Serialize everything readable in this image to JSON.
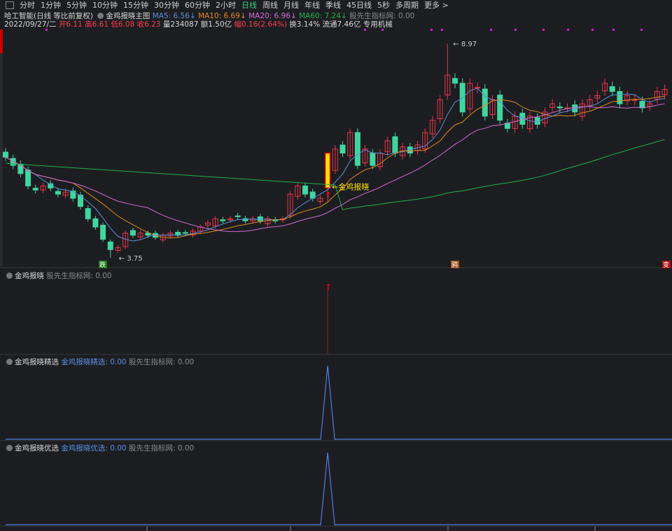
{
  "toolbar": {
    "periods": [
      "分时",
      "1分钟",
      "5分钟",
      "10分钟",
      "15分钟",
      "30分钟",
      "60分钟",
      "2小时",
      "日线",
      "周线",
      "月线",
      "年线",
      "季线",
      "45日线",
      "5秒",
      "多周期",
      "更多 >"
    ],
    "active": "日线"
  },
  "header": {
    "title": "哈工智能(日线 等比前复权)",
    "indicator": "金鸡报晓主图",
    "ma5": "MA5: 6.56",
    "ma10": "MA10: 6.69",
    "ma20": "MA20: 6.96",
    "ma60": "MA60: 7.24",
    "down_arrow": "↓",
    "site": "股先生指标网: 0.00",
    "date": "2022/09/27/二",
    "open": "开6.11",
    "high": "高6.61",
    "low": "低6.08",
    "close": "收6.23",
    "volume": "量234087",
    "amount": "额1.50亿",
    "change": "幅0.16(2.64%)",
    "turnover": "换3.14%",
    "float": "流通7.46亿",
    "sector": "专用机械"
  },
  "panels": [
    {
      "name": "金鸡报晓",
      "value_label": "",
      "site": "股先生指标网: 0.00"
    },
    {
      "name": "金鸡报晓精选",
      "value_label": "金鸡报晓精选: 0.00",
      "site": "股先生指标网: 0.00"
    },
    {
      "name": "金鸡报晓优选",
      "value_label": "金鸡报晓优选: 0.00",
      "site": "股先生指标网: 0.00"
    }
  ],
  "colors": {
    "up": "#e8344a",
    "down": "#3fd6a0",
    "ma5": "#5b8fd9",
    "ma10": "#e08a1e",
    "ma20": "#d36ad8",
    "ma60": "#21b14a",
    "signal": "#ffe600"
  },
  "chart_data": {
    "type": "candlestick",
    "closes": [
      6.2,
      6.0,
      5.8,
      5.5,
      5.4,
      5.5,
      5.45,
      5.3,
      5.35,
      5.2,
      5.0,
      4.7,
      4.5,
      4.2,
      3.95,
      4.0,
      4.35,
      4.3,
      4.35,
      4.3,
      4.25,
      4.3,
      4.35,
      4.3,
      4.35,
      4.4,
      4.5,
      4.6,
      4.7,
      4.65,
      4.7,
      4.75,
      4.65,
      4.7,
      4.65,
      4.7,
      4.65,
      4.7,
      5.3,
      5.5,
      5.3,
      5.2,
      5.2,
      5.85,
      6.4,
      6.3,
      6.8,
      6.0,
      6.4,
      6.0,
      6.3,
      6.6,
      6.3,
      6.45,
      6.3,
      6.5,
      6.8,
      7.1,
      7.6,
      8.2,
      8.0,
      7.3,
      8.0,
      7.9,
      7.2,
      7.6,
      7.1,
      6.9,
      7.2,
      7.0,
      7.2,
      7.0,
      7.3,
      7.5,
      7.4,
      7.4,
      7.3,
      7.5,
      7.6,
      7.7,
      8.0,
      7.8,
      7.5,
      7.7,
      7.6,
      7.4,
      7.5,
      7.8,
      7.85
    ],
    "high_label": "8.97",
    "low_label": "3.75",
    "signal_index": 43,
    "signal_label": "金鸡报晓",
    "markers": [
      {
        "index": 13,
        "text": "跌"
      },
      {
        "index": 60,
        "text": "鸦"
      },
      {
        "index": 89,
        "text": "变"
      }
    ],
    "yrange": [
      3.75,
      8.97
    ]
  }
}
